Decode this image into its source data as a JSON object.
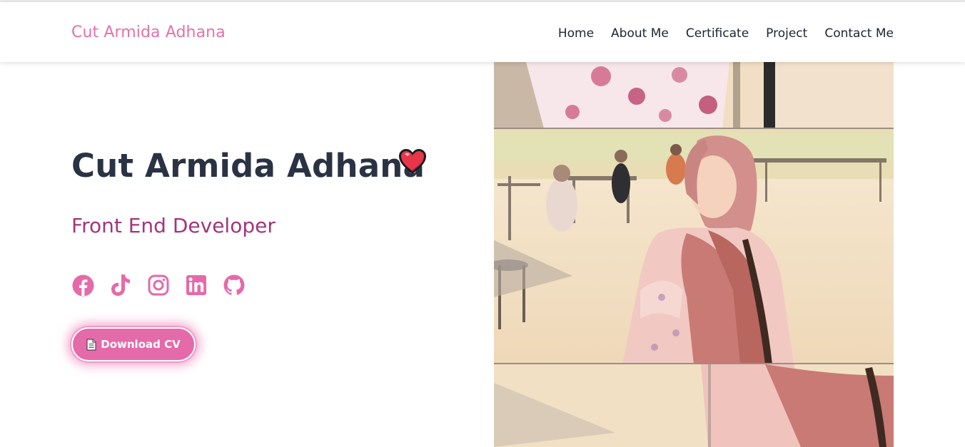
{
  "header": {
    "brand": "Cut Armida Adhana",
    "nav": [
      "Home",
      "About Me",
      "Certificate",
      "Project",
      "Contact Me"
    ]
  },
  "hero": {
    "name": "Cut Armida Adhana",
    "role": "Front End Developer",
    "cv_button": "Download CV",
    "socials": [
      "facebook-icon",
      "tiktok-icon",
      "instagram-icon",
      "linkedin-icon",
      "github-icon"
    ]
  },
  "colors": {
    "brand": "#e472a8",
    "heading": "#2a3343",
    "role": "#a3357c",
    "accent": "#e56aaa"
  }
}
